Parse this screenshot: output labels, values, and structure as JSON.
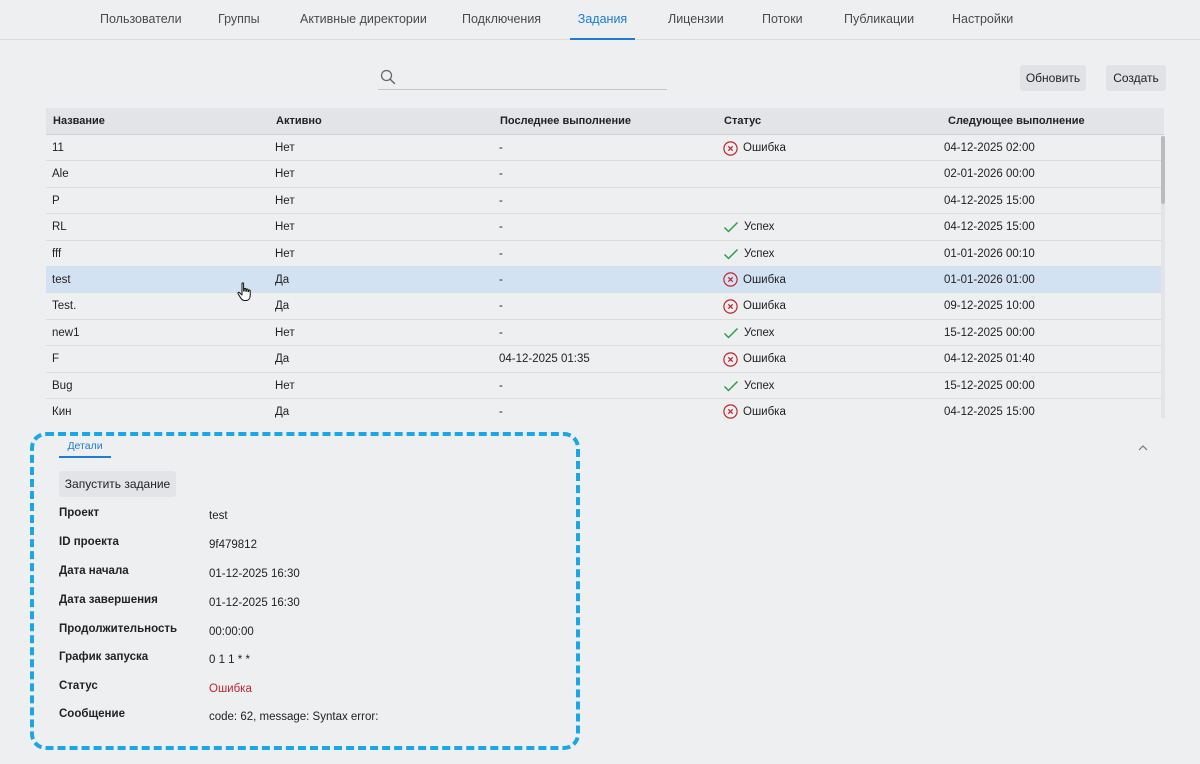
{
  "nav": {
    "tabs": [
      {
        "label": "Пользователи"
      },
      {
        "label": "Группы"
      },
      {
        "label": "Активные директории"
      },
      {
        "label": "Подключения"
      },
      {
        "label": "Задания"
      },
      {
        "label": "Лицензии"
      },
      {
        "label": "Потоки"
      },
      {
        "label": "Публикации"
      },
      {
        "label": "Настройки"
      }
    ],
    "active_tab": "Задания"
  },
  "search": {
    "placeholder": "",
    "value": "",
    "icon": "search-icon"
  },
  "toolbar": {
    "refresh_label": "Обновить",
    "create_label": "Создать"
  },
  "table": {
    "columns": [
      "Название",
      "Активно",
      "Последнее выполнение",
      "Статус",
      "Следующее выполнение"
    ],
    "rows": [
      {
        "name": "11",
        "active": "Нет",
        "last": "-",
        "status": "Ошибка",
        "status_type": "error",
        "next": "04-12-2025 02:00"
      },
      {
        "name": "Ale",
        "active": "Нет",
        "last": "-",
        "status": "",
        "status_type": "none",
        "next": "02-01-2026 00:00"
      },
      {
        "name": "P",
        "active": "Нет",
        "last": "-",
        "status": "",
        "status_type": "none",
        "next": "04-12-2025 15:00"
      },
      {
        "name": "RL",
        "active": "Нет",
        "last": "-",
        "status": "Успех",
        "status_type": "success",
        "next": "04-12-2025 15:00"
      },
      {
        "name": "fff",
        "active": "Нет",
        "last": "-",
        "status": "Успех",
        "status_type": "success",
        "next": "01-01-2026 00:10"
      },
      {
        "name": "test",
        "active": "Да",
        "last": "-",
        "status": "Ошибка",
        "status_type": "error",
        "next": "01-01-2026 01:00",
        "selected": true
      },
      {
        "name": "Test.",
        "active": "Да",
        "last": "-",
        "status": "Ошибка",
        "status_type": "error",
        "next": "09-12-2025 10:00"
      },
      {
        "name": "new1",
        "active": "Нет",
        "last": "-",
        "status": "Успех",
        "status_type": "success",
        "next": "15-12-2025 00:00"
      },
      {
        "name": "F",
        "active": "Да",
        "last": "04-12-2025 01:35",
        "status": "Ошибка",
        "status_type": "error",
        "next": "04-12-2025 01:40"
      },
      {
        "name": "Bug",
        "active": "Нет",
        "last": "-",
        "status": "Успех",
        "status_type": "success",
        "next": "15-12-2025 00:00"
      },
      {
        "name": "Кин",
        "active": "Да",
        "last": "-",
        "status": "Ошибка",
        "status_type": "error",
        "next": "04-12-2025 15:00"
      }
    ]
  },
  "details": {
    "tab_label": "Детали",
    "run_button": "Запустить задание",
    "fields": [
      {
        "label": "Проект",
        "value": "test"
      },
      {
        "label": "ID проекта",
        "value": "9f479812"
      },
      {
        "label": "Дата начала",
        "value": "01-12-2025 16:30"
      },
      {
        "label": "Дата завершения",
        "value": "01-12-2025 16:30"
      },
      {
        "label": "Продолжительность",
        "value": "00:00:00"
      },
      {
        "label": "График запуска",
        "value": "0 1 1 * *"
      },
      {
        "label": "Статус",
        "value": "Ошибка",
        "is_error": true
      },
      {
        "label": "Сообщение",
        "value": "code: 62, message: Syntax error:"
      }
    ]
  },
  "colors": {
    "accent": "#1c7cd6",
    "error": "#c0272d",
    "success": "#2e9e4a",
    "selected_row": "#d3e2f3",
    "highlight_dash": "#1aa7e8"
  }
}
